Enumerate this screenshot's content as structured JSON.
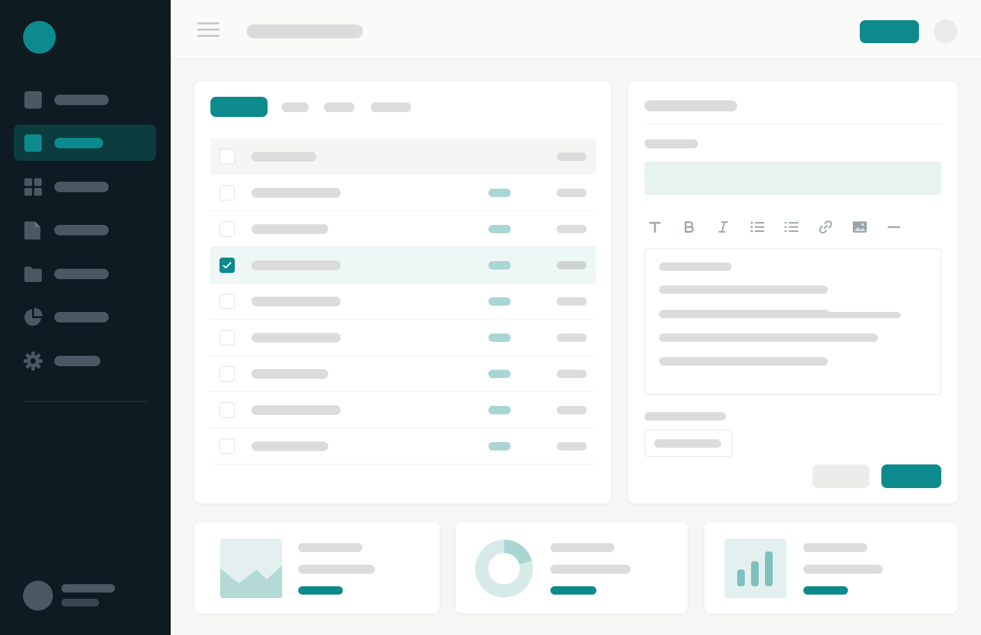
{
  "header": {
    "title": "",
    "primary_action": "",
    "menu_icon": "hamburger-menu-icon"
  },
  "sidebar": {
    "items": [
      {
        "label": "",
        "icon": "square-icon",
        "active": false
      },
      {
        "label": "",
        "icon": "square-icon",
        "active": true
      },
      {
        "label": "",
        "icon": "grid-icon",
        "active": false
      },
      {
        "label": "",
        "icon": "file-icon",
        "active": false
      },
      {
        "label": "",
        "icon": "folder-icon",
        "active": false
      },
      {
        "label": "",
        "icon": "pie-chart-icon",
        "active": false
      },
      {
        "label": "",
        "icon": "gear-icon",
        "active": false
      }
    ],
    "user": {
      "name": "",
      "role": ""
    }
  },
  "table": {
    "tabs": [
      "",
      "",
      "",
      ""
    ],
    "active_tab": 0,
    "columns": [
      "",
      "",
      ""
    ],
    "rows": [
      {
        "name": "",
        "status": "",
        "value": "",
        "checked": false
      },
      {
        "name": "",
        "status": "",
        "value": "",
        "checked": false
      },
      {
        "name": "",
        "status": "",
        "value": "",
        "checked": true
      },
      {
        "name": "",
        "status": "",
        "value": "",
        "checked": false
      },
      {
        "name": "",
        "status": "",
        "value": "",
        "checked": false
      },
      {
        "name": "",
        "status": "",
        "value": "",
        "checked": false
      },
      {
        "name": "",
        "status": "",
        "value": "",
        "checked": false
      },
      {
        "name": "",
        "status": "",
        "value": "",
        "checked": false
      }
    ]
  },
  "editor": {
    "title": "",
    "field_label": "",
    "field_value": "",
    "toolbar": [
      {
        "icon": "text-style-icon",
        "label": "T"
      },
      {
        "icon": "bold-icon",
        "label": "B"
      },
      {
        "icon": "italic-icon",
        "label": "I"
      },
      {
        "icon": "bulleted-list-icon",
        "label": ""
      },
      {
        "icon": "numbered-list-icon",
        "label": ""
      },
      {
        "icon": "link-icon",
        "label": ""
      },
      {
        "icon": "image-icon",
        "label": ""
      },
      {
        "icon": "horizontal-rule-icon",
        "label": ""
      }
    ],
    "body": "",
    "secondary_label": "",
    "secondary_value": "",
    "cancel_label": "",
    "save_label": ""
  },
  "stats": [
    {
      "icon": "area-chart-icon",
      "title": "",
      "subtitle": "",
      "value": ""
    },
    {
      "icon": "donut-chart-icon",
      "title": "",
      "subtitle": "",
      "value": ""
    },
    {
      "icon": "bar-chart-icon",
      "title": "",
      "subtitle": "",
      "value": ""
    }
  ],
  "colors": {
    "accent": "#0d8a8c",
    "sidebar_bg": "#0f1b23",
    "sidebar_active": "#0b3d40",
    "page_bg": "#f6f6f5",
    "status_pill": "#a9d6d3"
  }
}
